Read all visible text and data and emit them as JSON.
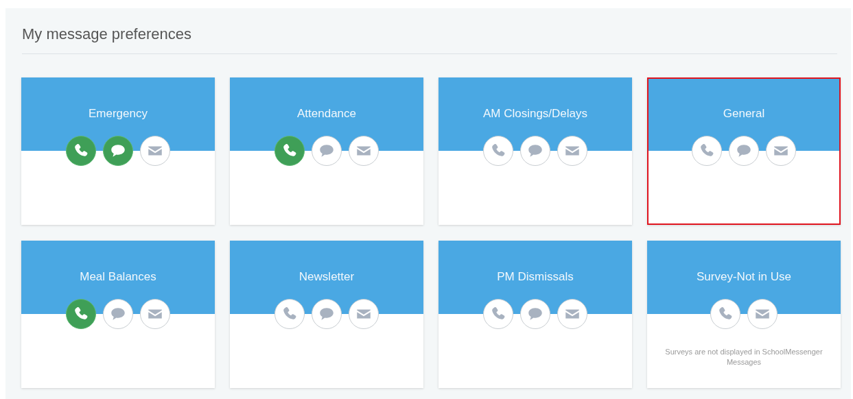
{
  "title": "My message preferences",
  "cards": [
    {
      "name": "Emergency",
      "highlighted": false,
      "channels": [
        {
          "kind": "phone",
          "on": true
        },
        {
          "kind": "text",
          "on": true
        },
        {
          "kind": "email",
          "on": false
        }
      ]
    },
    {
      "name": "Attendance",
      "highlighted": false,
      "channels": [
        {
          "kind": "phone",
          "on": true
        },
        {
          "kind": "text",
          "on": false
        },
        {
          "kind": "email",
          "on": false
        }
      ]
    },
    {
      "name": "AM Closings/Delays",
      "highlighted": false,
      "channels": [
        {
          "kind": "phone",
          "on": false
        },
        {
          "kind": "text",
          "on": false
        },
        {
          "kind": "email",
          "on": false
        }
      ]
    },
    {
      "name": "General",
      "highlighted": true,
      "channels": [
        {
          "kind": "phone",
          "on": false
        },
        {
          "kind": "text",
          "on": false
        },
        {
          "kind": "email",
          "on": false
        }
      ]
    },
    {
      "name": "Meal Balances",
      "highlighted": false,
      "channels": [
        {
          "kind": "phone",
          "on": true
        },
        {
          "kind": "text",
          "on": false
        },
        {
          "kind": "email",
          "on": false
        }
      ]
    },
    {
      "name": "Newsletter",
      "highlighted": false,
      "channels": [
        {
          "kind": "phone",
          "on": false
        },
        {
          "kind": "text",
          "on": false
        },
        {
          "kind": "email",
          "on": false
        }
      ]
    },
    {
      "name": "PM Dismissals",
      "highlighted": false,
      "channels": [
        {
          "kind": "phone",
          "on": false
        },
        {
          "kind": "text",
          "on": false
        },
        {
          "kind": "email",
          "on": false
        }
      ]
    },
    {
      "name": "Survey-Not in Use",
      "highlighted": false,
      "channels": [
        {
          "kind": "phone",
          "on": false
        },
        {
          "kind": "email",
          "on": false
        }
      ],
      "note": "Surveys are not displayed in SchoolMessenger Messages"
    }
  ]
}
